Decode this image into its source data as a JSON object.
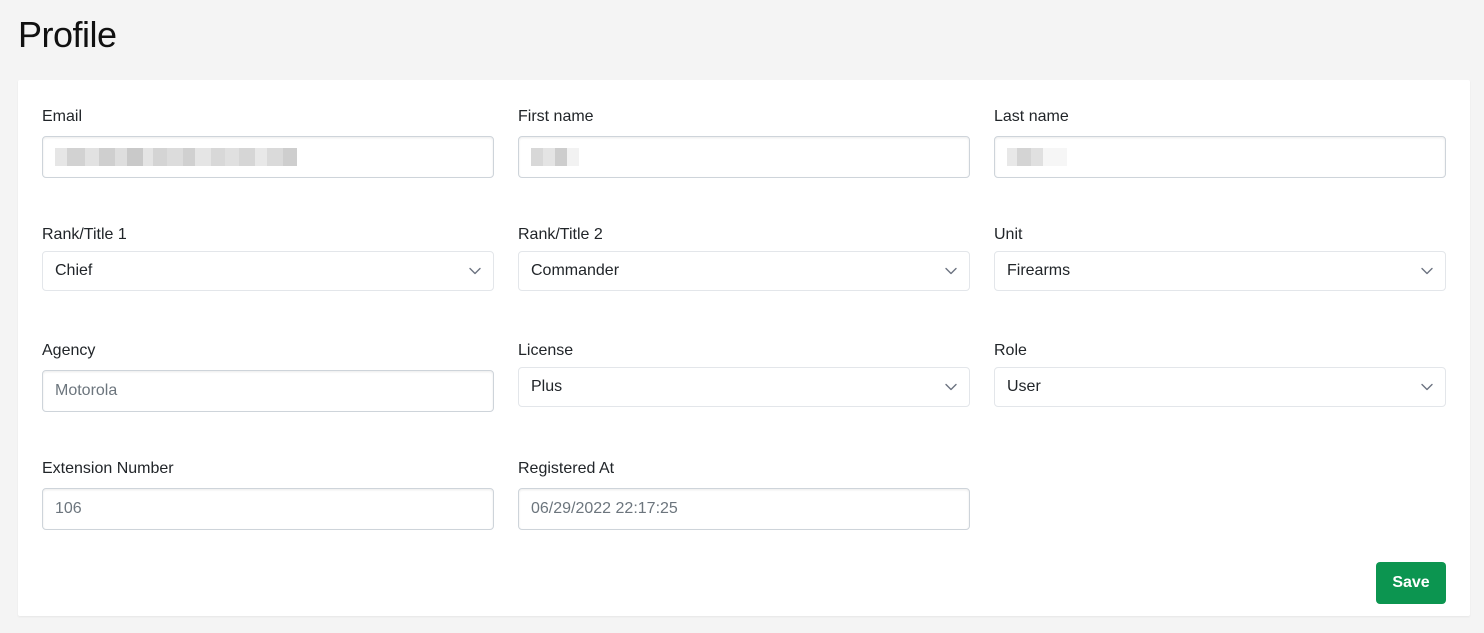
{
  "page": {
    "title": "Profile"
  },
  "form": {
    "email": {
      "label": "Email",
      "value": ""
    },
    "first_name": {
      "label": "First name",
      "value": ""
    },
    "last_name": {
      "label": "Last name",
      "value": ""
    },
    "rank_title_1": {
      "label": "Rank/Title 1",
      "selected": "Chief"
    },
    "rank_title_2": {
      "label": "Rank/Title 2",
      "selected": "Commander"
    },
    "unit": {
      "label": "Unit",
      "selected": "Firearms"
    },
    "agency": {
      "label": "Agency",
      "value": "Motorola"
    },
    "license": {
      "label": "License",
      "selected": "Plus"
    },
    "role": {
      "label": "Role",
      "selected": "User"
    },
    "extension_number": {
      "label": "Extension Number",
      "value": "106"
    },
    "registered_at": {
      "label": "Registered At",
      "value": "06/29/2022 22:17:25"
    }
  },
  "actions": {
    "save_label": "Save"
  },
  "colors": {
    "save_button": "#0c9550",
    "page_background": "#f4f4f4"
  },
  "icons": {
    "select_chevron": "chevron-down-icon"
  }
}
